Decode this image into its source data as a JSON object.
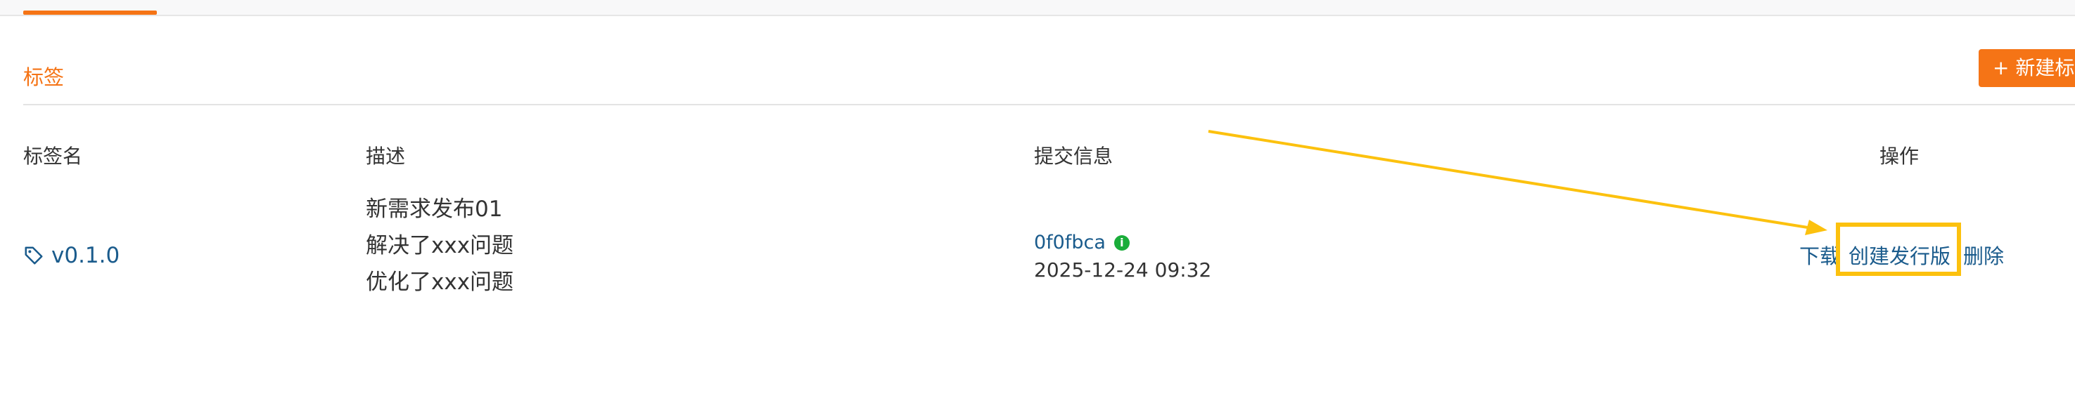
{
  "section": {
    "title": "标签",
    "new_button": "+ 新建标签"
  },
  "table": {
    "headers": [
      "标签名",
      "描述",
      "提交信息",
      "操作"
    ],
    "rows": [
      {
        "tag": "v0.1.0",
        "description": [
          "新需求发布01",
          "解决了xxx问题",
          "优化了xxx问题"
        ],
        "commit_hash": "0f0fbca",
        "commit_time": "2025-12-24 09:32",
        "actions": [
          "下载",
          "创建发行版",
          "删除"
        ]
      }
    ]
  },
  "colors": {
    "accent": "#f57416",
    "link": "#1a5b8c",
    "highlight": "#fcc10e",
    "info_badge": "#1aad3a"
  },
  "icons": [
    "tag-icon",
    "info-icon",
    "arrow-annotation"
  ]
}
